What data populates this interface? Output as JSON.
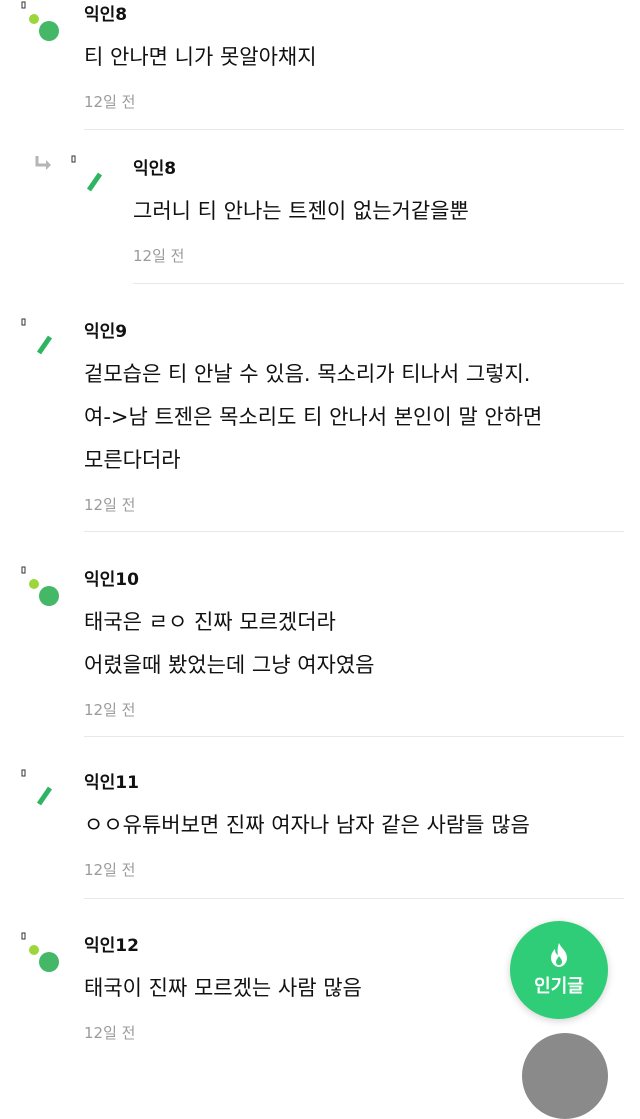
{
  "comments": [
    {
      "author": "익인8",
      "content": "티 안나면 니가 못알아채지",
      "time": "12일 전",
      "avatar": "dots-icon",
      "reply": false
    },
    {
      "author": "익인8",
      "content": "그러니 티 안나는 트젠이 없는거같을뿐",
      "time": "12일 전",
      "avatar": "slash-icon",
      "reply": true
    },
    {
      "author": "익인9",
      "content": "겉모습은 티 안날 수 있음. 목소리가 티나서 그렇지.\n여->남 트젠은 목소리도 티 안나서 본인이 말 안하면\n모른다더라",
      "time": "12일 전",
      "avatar": "slash-icon",
      "reply": false
    },
    {
      "author": "익인10",
      "content": "태국은 ㄹㅇ 진짜 모르겠더라\n어렸을때 봤었는데 그냥 여자였음",
      "time": "12일 전",
      "avatar": "dots-icon",
      "reply": false
    },
    {
      "author": "익인11",
      "content": "ㅇㅇ유튜버보면 진짜 여자나 남자 같은 사람들 많음",
      "time": "12일 전",
      "avatar": "slash-icon",
      "reply": false
    },
    {
      "author": "익인12",
      "content": "태국이 진짜 모르겠는 사람 많음",
      "time": "12일 전",
      "avatar": "dots-icon",
      "reply": false
    }
  ],
  "fab": {
    "label": "인기글",
    "icon": "flame-icon"
  },
  "colors": {
    "accent": "#2fcd78",
    "timestamp": "#9b9b9b",
    "divider": "#e8e8e8"
  }
}
